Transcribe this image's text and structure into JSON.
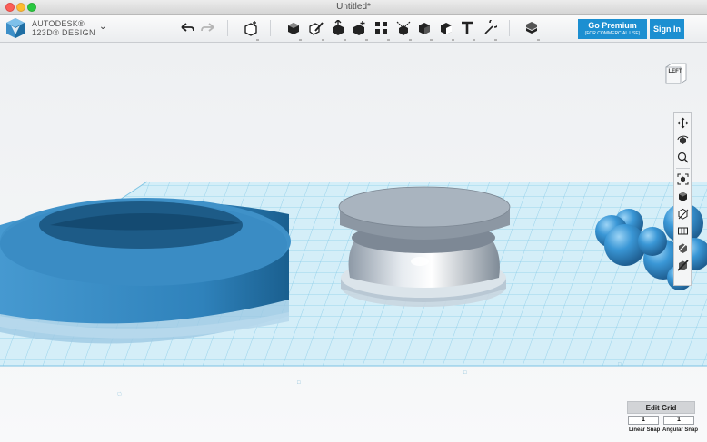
{
  "window": {
    "title": "Untitled*"
  },
  "brand": {
    "line1": "AUTODESK®",
    "line2": "123D® DESIGN"
  },
  "toolbar": {
    "buttons": [
      "undo",
      "redo",
      "primitives",
      "sketch",
      "construct",
      "modify",
      "pattern",
      "grouping",
      "combine",
      "measure",
      "text",
      "snap",
      "material"
    ]
  },
  "premium": {
    "label": "Go Premium",
    "sublabel": "(FOR COMMERCIAL USE)"
  },
  "signin": {
    "label": "Sign In"
  },
  "viewcube": {
    "face": "LEFT"
  },
  "navbar": {
    "tools": [
      "pan",
      "orbit",
      "zoom",
      "fit",
      "solid",
      "outline",
      "wireframe",
      "materials",
      "hide-all"
    ]
  },
  "grid": {
    "edit_label": "Edit Grid",
    "linear_snap": "1",
    "angular_snap": "1",
    "linear_label": "Linear Snap",
    "angular_label": "Angular Snap"
  },
  "colors": {
    "accent": "#1c8fd1",
    "grid": "#8fd0ec",
    "ring": "#3a8fc6",
    "spheres": "#3a97d6",
    "spool": "#a9b4bf"
  }
}
